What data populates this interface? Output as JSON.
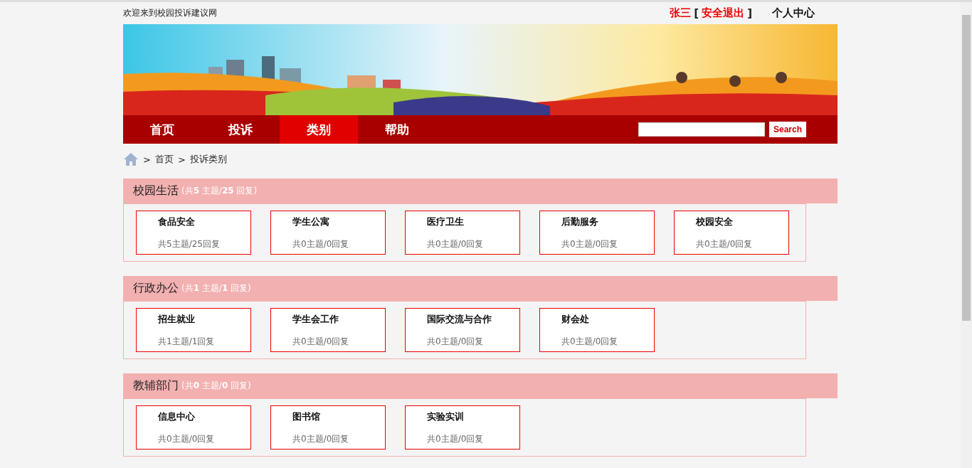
{
  "top_bar": {
    "welcome": "欢迎来到校园投诉建议网",
    "user": "张三",
    "bracket_open": "[",
    "logout": "安全退出",
    "bracket_close": "]",
    "profile": "个人中心"
  },
  "nav": {
    "items": [
      {
        "label": "首页",
        "selected": false
      },
      {
        "label": "投诉",
        "selected": false
      },
      {
        "label": "类别",
        "selected": true
      },
      {
        "label": "帮助",
        "selected": false
      }
    ],
    "search_button": "Search"
  },
  "breadcrumb": [
    {
      "sep": ">",
      "label": "首页"
    },
    {
      "sep": ">",
      "label": "投诉类别"
    }
  ],
  "sections": [
    {
      "title": "校园生活",
      "stats": "(共**5** 主题/**25** 回复)",
      "categories": [
        {
          "name": "食品安全",
          "stats": "共5主题/25回复"
        },
        {
          "name": "学生公寓",
          "stats": "共0主题/0回复"
        },
        {
          "name": "医疗卫生",
          "stats": "共0主题/0回复"
        },
        {
          "name": "后勤服务",
          "stats": "共0主题/0回复"
        },
        {
          "name": "校园安全",
          "stats": "共0主题/0回复"
        }
      ]
    },
    {
      "title": "行政办公",
      "stats": "(共**1** 主题/**1** 回复)",
      "categories": [
        {
          "name": "招生就业",
          "stats": "共1主题/1回复"
        },
        {
          "name": "学生会工作",
          "stats": "共0主题/0回复"
        },
        {
          "name": "国际交流与合作",
          "stats": "共0主题/0回复"
        },
        {
          "name": "财会处",
          "stats": "共0主题/0回复"
        }
      ]
    },
    {
      "title": "教辅部门",
      "stats": "(共**0** 主题/**0** 回复)",
      "categories": [
        {
          "name": "信息中心",
          "stats": "共0主题/0回复"
        },
        {
          "name": "图书馆",
          "stats": "共0主题/0回复"
        },
        {
          "name": "实验实训",
          "stats": "共0主题/0回复"
        }
      ]
    }
  ]
}
